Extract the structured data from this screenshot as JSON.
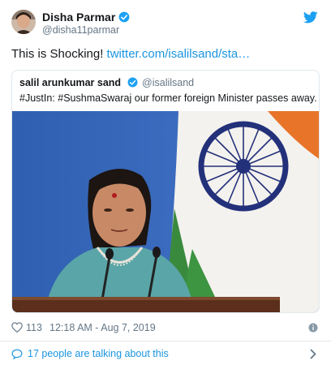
{
  "author": {
    "name": "Disha Parmar",
    "handle": "@disha11parmar"
  },
  "tweet": {
    "text": "This is Shocking! ",
    "link": "twitter.com/isalilsand/sta…"
  },
  "quoted": {
    "name": "salil arunkumar sand",
    "handle": "@isalilsand",
    "text": "#JustIn: #SushmaSwaraj our former foreign Minister passes away."
  },
  "meta": {
    "likes": "113",
    "timestamp": "12:18 AM - Aug 7, 2019"
  },
  "footer": {
    "talking": "17 people are talking about this"
  },
  "colors": {
    "link": "#1b95e0",
    "verified": "#1da1f2",
    "muted": "#657786"
  }
}
